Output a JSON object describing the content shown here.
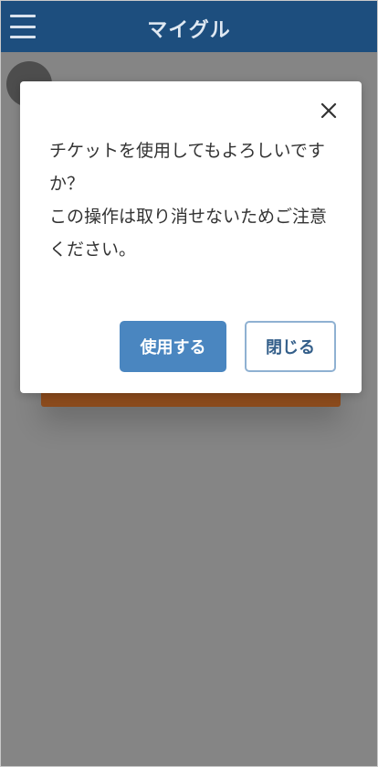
{
  "header": {
    "title": "マイグル",
    "menu_icon": "hamburger-menu-icon"
  },
  "dialog": {
    "message": "チケットを使用してもよろしいです\nか？\nこの操作は取り消せないためご注意\nください。",
    "close_icon": "close-icon",
    "confirm_label": "使用する",
    "close_label": "閉じる"
  },
  "colors": {
    "header_bg": "#1d4e7e",
    "overlay": "#858585",
    "primary_button": "#4a86c0",
    "card_accent": "#8a4a1c"
  }
}
